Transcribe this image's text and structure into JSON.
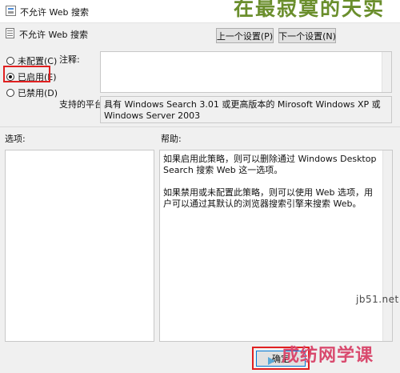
{
  "window": {
    "title": "不允许 Web 搜索",
    "icon": "policy-icon"
  },
  "header": {
    "policy_name": "不允许 Web 搜索",
    "prev_button": "上一个设置(P)",
    "next_button": "下一个设置(N)"
  },
  "state": {
    "options": [
      {
        "label": "未配置(C)",
        "selected": false
      },
      {
        "label": "已启用(E)",
        "selected": true
      },
      {
        "label": "已禁用(D)",
        "selected": false
      }
    ]
  },
  "comment": {
    "label": "注释:",
    "value": ""
  },
  "platform": {
    "label": "支持的平台:",
    "value": "具有 Windows Search 3.01 或更高版本的 Mirosoft Windows XP 或 Windows Server 2003"
  },
  "options_panel": {
    "label": "选项:"
  },
  "help_panel": {
    "label": "帮助:",
    "paragraphs": [
      "如果启用此策略，则可以删除通过 Windows Desktop Search 搜索 Web 这一选项。",
      "如果禁用或未配置此策略，则可以使用 Web 选项，用户可以通过其默认的浏览器搜索引擎来搜索 Web。"
    ]
  },
  "footer": {
    "ok_button": "确定"
  },
  "watermarks": {
    "top_right": "在最寂寞的天实",
    "site": "jb51.net",
    "bottom": "成纺网学课"
  },
  "highlight_color": "#e02020"
}
